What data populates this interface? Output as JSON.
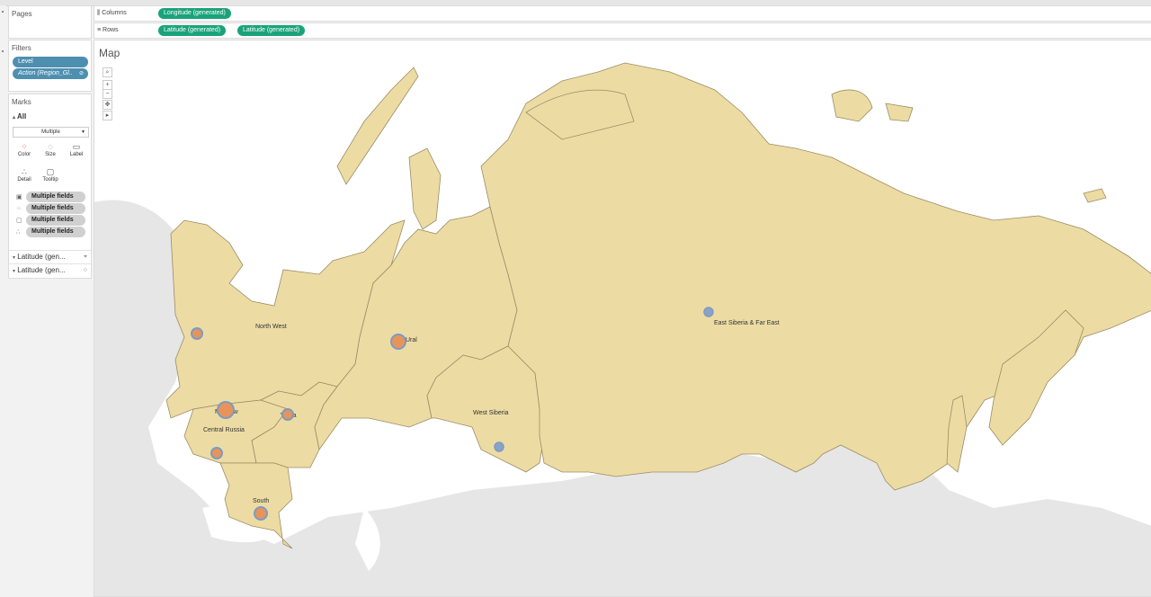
{
  "pages_card": {
    "title": "Pages"
  },
  "filters_card": {
    "title": "Filters",
    "items": [
      "Level",
      "Action (Region_Gl.."
    ]
  },
  "marks_card": {
    "title": "Marks",
    "all_label": "All",
    "mark_type": "Multiple",
    "buttons": {
      "color": "Color",
      "size": "Size",
      "label": "Label",
      "detail": "Detail",
      "tooltip": "Tooltip"
    },
    "fields": [
      "Multiple fields",
      "Multiple fields",
      "Multiple fields",
      "Multiple fields"
    ],
    "layers": [
      "Latitude (gen...",
      "Latitude (gen..."
    ]
  },
  "shelves": {
    "columns_label": "Columns",
    "columns_pills": [
      "Longitude (generated)"
    ],
    "rows_label": "Rows",
    "rows_pills": [
      "Latitude (generated)",
      "Latitude (generated)"
    ]
  },
  "view": {
    "title": "Map",
    "map_controls": {
      "search": "⌕",
      "zoom_in": "+",
      "zoom_out": "−",
      "pan": "▸"
    }
  },
  "map_regions": {
    "north_west": "North West",
    "ural": "Ural",
    "east_siberia": "East Siberia & Far East",
    "moscow": "Moscow",
    "volga": "Volga",
    "central_russia": "Central Russia",
    "west_siberia": "West Siberia",
    "south": "South"
  },
  "colors": {
    "land_fill": "#ecdca4",
    "land_border": "#9c8c63",
    "background_land": "#e6e6e6",
    "mark_orange": "#e8935a",
    "mark_ring": "#7b9cc4",
    "pill_green": "#1aa37a",
    "pill_blue": "#4e8fb0"
  }
}
